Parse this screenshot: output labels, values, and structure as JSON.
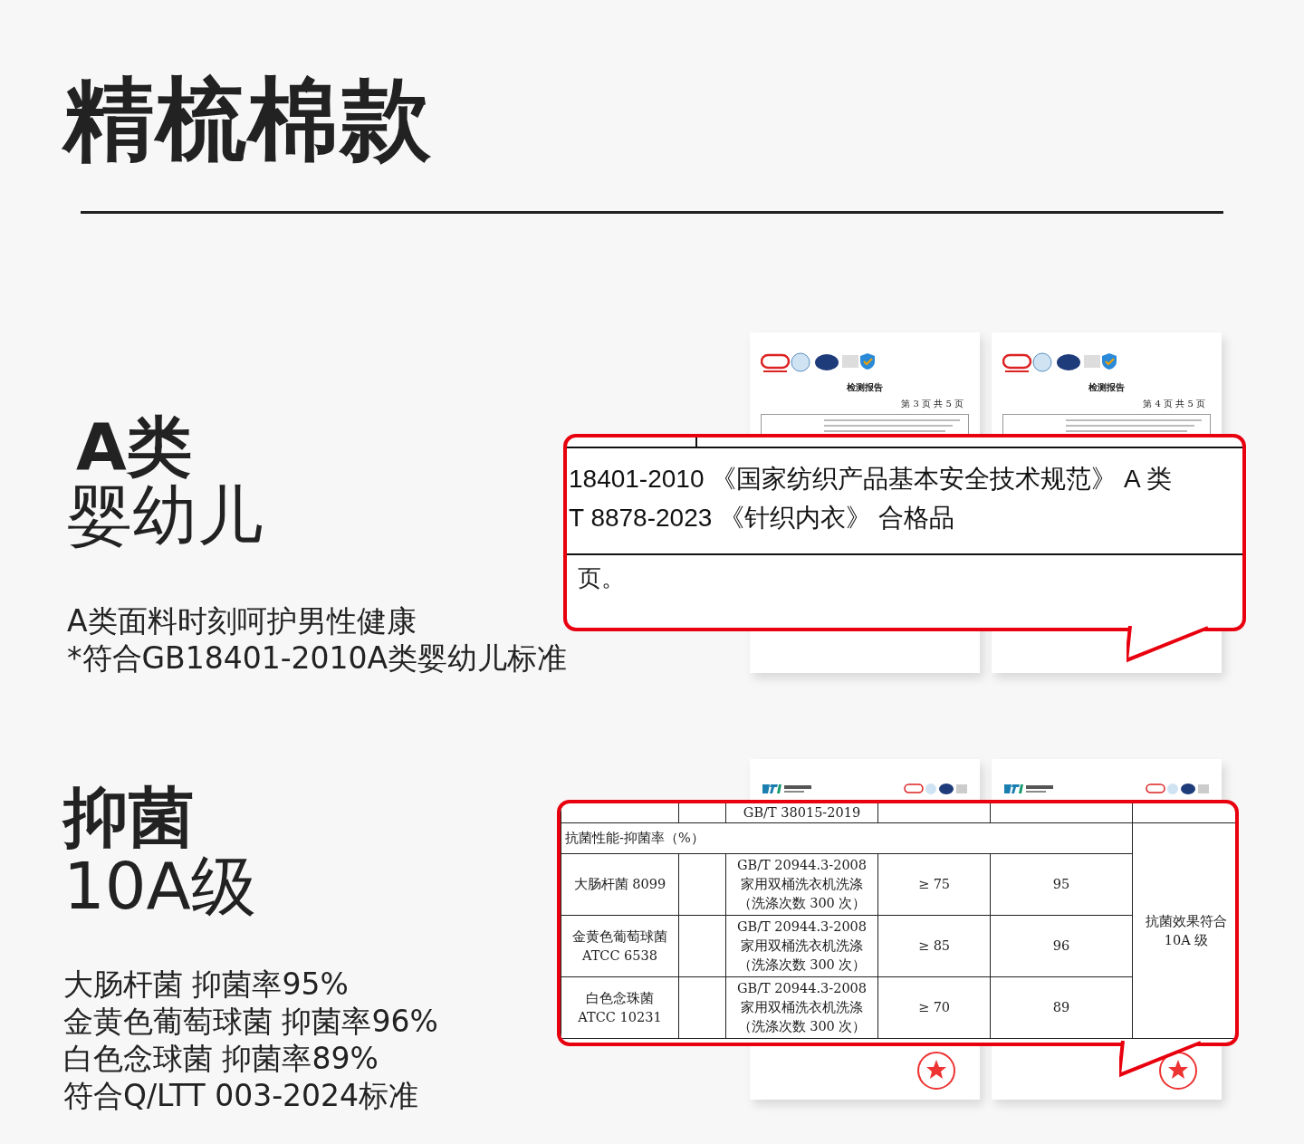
{
  "title": "精梳棉款",
  "sections": [
    {
      "kind": "text_callout",
      "heading": [
        {
          "text": "A类",
          "bold": true
        },
        {
          "text": "婴幼儿",
          "bold": false
        }
      ],
      "notes": [
        "A类面料时刻呵护男性健康",
        "*符合GB18401-2010A类婴幼儿标准"
      ],
      "reports": [
        {
          "kind": "cma",
          "doc_title": "检测报告",
          "page": "第 3 页 共 5 页"
        },
        {
          "kind": "cma",
          "doc_title": "检测报告",
          "page": "第 4 页 共 5 页"
        }
      ],
      "callout": {
        "lines": [
          "18401-2010 《国家纺织产品基本安全技术规范》 A 类",
          "T 8878-2023 《针织内衣》 合格品"
        ],
        "after_rule": "页。"
      }
    },
    {
      "kind": "table_callout",
      "heading": [
        {
          "text": "抑菌",
          "bold": true
        },
        {
          "text": "10A级",
          "bold": false
        }
      ],
      "notes": [
        "大肠杆菌 抑菌率95%",
        "金黄色葡萄球菌 抑菌率96%",
        "白色念球菌 抑菌率89%",
        "符合Q/LTT 003-2024标准"
      ],
      "reports": [
        {
          "kind": "ltt"
        },
        {
          "kind": "ltt"
        }
      ],
      "callout": {
        "top_standard": "GB/T 38015-2019",
        "group_label": "抗菌性能-抑菌率（%）",
        "rows": [
          {
            "strain": [
              "大肠杆菌 8099"
            ],
            "method": [
              "GB/T 20944.3-2008",
              "家用双桶洗衣机洗涤",
              "（洗涤次数 300 次）"
            ],
            "requirement": "≥ 75",
            "result": "95"
          },
          {
            "strain": [
              "金黄色葡萄球菌",
              "ATCC 6538"
            ],
            "method": [
              "GB/T 20944.3-2008",
              "家用双桶洗衣机洗涤",
              "（洗涤次数 300 次）"
            ],
            "requirement": "≥ 85",
            "result": "96"
          },
          {
            "strain": [
              "白色念珠菌",
              "ATCC 10231"
            ],
            "method": [
              "GB/T 20944.3-2008",
              "家用双桶洗衣机洗涤",
              "（洗涤次数 300 次）"
            ],
            "requirement": "≥ 70",
            "result": "89"
          }
        ],
        "verdict": [
          "抗菌效果符合",
          "10A 级"
        ]
      }
    }
  ]
}
